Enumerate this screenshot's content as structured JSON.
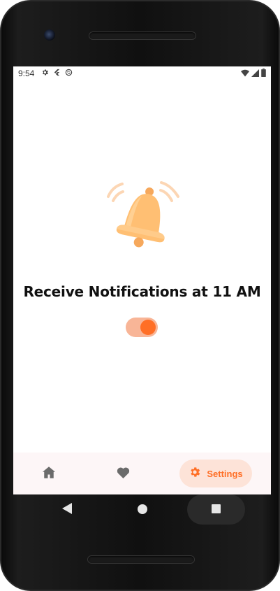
{
  "status_bar": {
    "time": "9:54",
    "left_icons": [
      "gear-icon",
      "flutter-icon",
      "sync-icon"
    ],
    "right_icons": [
      "wifi-icon",
      "signal-icon",
      "battery-icon"
    ]
  },
  "main": {
    "illustration": "bell-icon",
    "title": "Receive Notifications at 11 AM",
    "toggle_on": true
  },
  "bottom_nav": {
    "items": [
      {
        "name": "home",
        "icon": "home-icon",
        "label": "",
        "selected": false
      },
      {
        "name": "favorites",
        "icon": "heart-icon",
        "label": "",
        "selected": false
      },
      {
        "name": "settings",
        "icon": "gear-icon",
        "label": "Settings",
        "selected": true
      }
    ]
  },
  "system_nav": [
    "back-icon",
    "home-circle-icon",
    "recents-icon"
  ],
  "colors": {
    "accent": "#ff6f26",
    "toggle_track": "#f8b597",
    "selected_pill": "#fde3d8",
    "bell": "#ffbf73",
    "nav_background": "#fdf6f7",
    "icon_gray": "#6b6b6b"
  }
}
